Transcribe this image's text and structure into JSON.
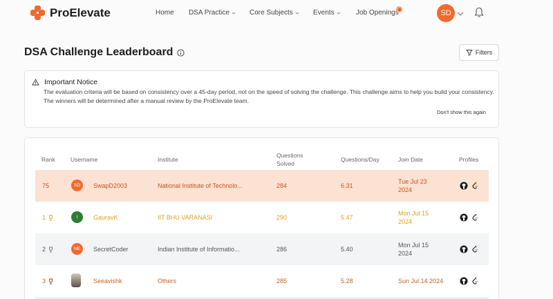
{
  "brand": {
    "name": "ProElevate"
  },
  "nav": {
    "items": [
      {
        "label": "Home"
      },
      {
        "label": "DSA Practice"
      },
      {
        "label": "Core Subjects"
      },
      {
        "label": "Events"
      },
      {
        "label": "Job Openings"
      }
    ],
    "avatar_initials": "SD"
  },
  "page": {
    "title": "DSA Challenge Leaderboard",
    "filters_label": "Filters"
  },
  "notice": {
    "title": "Important Notice",
    "text": "The evaluation criteria will be based on consistency over a 45-day period, not on the speed of solving the challenge. This challenge aims to help you build your consistency. The winners will be determined after a manual review by the ProElevate team.",
    "dismiss_label": "Don't show this again"
  },
  "table": {
    "headers": {
      "rank": "Rank",
      "username": "Username",
      "institute": "Institute",
      "questions_solved_1": "Questions",
      "questions_solved_2": "Solved",
      "qpd": "Questions/Day",
      "join_date": "Join Date",
      "profiles": "Profiles"
    },
    "rows": [
      {
        "rank": "75",
        "initials": "SD",
        "avatar_color": "#f26a2e",
        "username": "SwapD2003",
        "institute": "National Institute of Technolo...",
        "solved": "284",
        "qpd": "6.31",
        "join_1": "Tue Jul 23",
        "join_2": "2024",
        "highlight": "self"
      },
      {
        "rank": "1",
        "initials": "I",
        "avatar_color": "#2e7d32",
        "username": "GauravK",
        "institute": "IIT BHU VARANASI",
        "solved": "290",
        "qpd": "5.47",
        "join_1": "Mon Jul 15",
        "join_2": "2024",
        "highlight": "gold"
      },
      {
        "rank": "2",
        "initials": "NE",
        "avatar_color": "#f26a2e",
        "username": "SecretCoder",
        "institute": "Indian Institute of Informatio...",
        "solved": "286",
        "qpd": "5.40",
        "join_1": "Mon Jul 15",
        "join_2": "2024",
        "highlight": "silver"
      },
      {
        "rank": "3",
        "initials": "",
        "avatar_color": "#8a7d6e",
        "username": "Seeavishk",
        "institute": "Others",
        "solved": "285",
        "qpd": "5.28",
        "join_1": "Sun Jul 14 2024",
        "join_2": "",
        "highlight": "bronze"
      }
    ]
  },
  "colors": {
    "accent": "#f26a2e",
    "self_row_bg": "#fbe2d3",
    "silver_row_bg": "#f2f4f5",
    "gold_text": "#e0a21a",
    "bronze_text": "#c8631c"
  },
  "icons": [
    "info-icon",
    "filter-icon",
    "warning-icon",
    "trophy-icon",
    "github-icon",
    "leetcode-icon",
    "bell-icon",
    "chevron-down-icon"
  ]
}
